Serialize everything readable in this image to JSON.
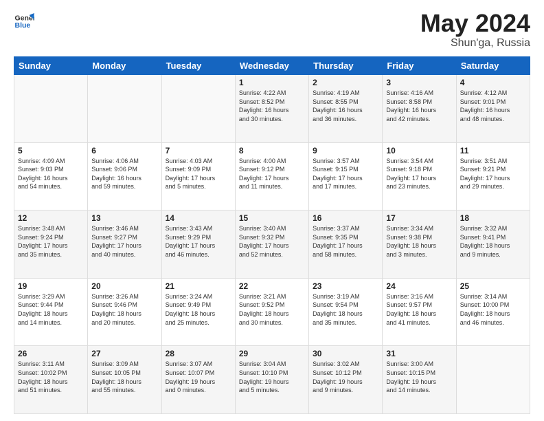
{
  "logo": {
    "line1": "General",
    "line2": "Blue"
  },
  "title": {
    "month_year": "May 2024",
    "location": "Shun'ga, Russia"
  },
  "days_of_week": [
    "Sunday",
    "Monday",
    "Tuesday",
    "Wednesday",
    "Thursday",
    "Friday",
    "Saturday"
  ],
  "weeks": [
    [
      {
        "day": "",
        "info": ""
      },
      {
        "day": "",
        "info": ""
      },
      {
        "day": "",
        "info": ""
      },
      {
        "day": "1",
        "info": "Sunrise: 4:22 AM\nSunset: 8:52 PM\nDaylight: 16 hours\nand 30 minutes."
      },
      {
        "day": "2",
        "info": "Sunrise: 4:19 AM\nSunset: 8:55 PM\nDaylight: 16 hours\nand 36 minutes."
      },
      {
        "day": "3",
        "info": "Sunrise: 4:16 AM\nSunset: 8:58 PM\nDaylight: 16 hours\nand 42 minutes."
      },
      {
        "day": "4",
        "info": "Sunrise: 4:12 AM\nSunset: 9:01 PM\nDaylight: 16 hours\nand 48 minutes."
      }
    ],
    [
      {
        "day": "5",
        "info": "Sunrise: 4:09 AM\nSunset: 9:03 PM\nDaylight: 16 hours\nand 54 minutes."
      },
      {
        "day": "6",
        "info": "Sunrise: 4:06 AM\nSunset: 9:06 PM\nDaylight: 16 hours\nand 59 minutes."
      },
      {
        "day": "7",
        "info": "Sunrise: 4:03 AM\nSunset: 9:09 PM\nDaylight: 17 hours\nand 5 minutes."
      },
      {
        "day": "8",
        "info": "Sunrise: 4:00 AM\nSunset: 9:12 PM\nDaylight: 17 hours\nand 11 minutes."
      },
      {
        "day": "9",
        "info": "Sunrise: 3:57 AM\nSunset: 9:15 PM\nDaylight: 17 hours\nand 17 minutes."
      },
      {
        "day": "10",
        "info": "Sunrise: 3:54 AM\nSunset: 9:18 PM\nDaylight: 17 hours\nand 23 minutes."
      },
      {
        "day": "11",
        "info": "Sunrise: 3:51 AM\nSunset: 9:21 PM\nDaylight: 17 hours\nand 29 minutes."
      }
    ],
    [
      {
        "day": "12",
        "info": "Sunrise: 3:48 AM\nSunset: 9:24 PM\nDaylight: 17 hours\nand 35 minutes."
      },
      {
        "day": "13",
        "info": "Sunrise: 3:46 AM\nSunset: 9:27 PM\nDaylight: 17 hours\nand 40 minutes."
      },
      {
        "day": "14",
        "info": "Sunrise: 3:43 AM\nSunset: 9:29 PM\nDaylight: 17 hours\nand 46 minutes."
      },
      {
        "day": "15",
        "info": "Sunrise: 3:40 AM\nSunset: 9:32 PM\nDaylight: 17 hours\nand 52 minutes."
      },
      {
        "day": "16",
        "info": "Sunrise: 3:37 AM\nSunset: 9:35 PM\nDaylight: 17 hours\nand 58 minutes."
      },
      {
        "day": "17",
        "info": "Sunrise: 3:34 AM\nSunset: 9:38 PM\nDaylight: 18 hours\nand 3 minutes."
      },
      {
        "day": "18",
        "info": "Sunrise: 3:32 AM\nSunset: 9:41 PM\nDaylight: 18 hours\nand 9 minutes."
      }
    ],
    [
      {
        "day": "19",
        "info": "Sunrise: 3:29 AM\nSunset: 9:44 PM\nDaylight: 18 hours\nand 14 minutes."
      },
      {
        "day": "20",
        "info": "Sunrise: 3:26 AM\nSunset: 9:46 PM\nDaylight: 18 hours\nand 20 minutes."
      },
      {
        "day": "21",
        "info": "Sunrise: 3:24 AM\nSunset: 9:49 PM\nDaylight: 18 hours\nand 25 minutes."
      },
      {
        "day": "22",
        "info": "Sunrise: 3:21 AM\nSunset: 9:52 PM\nDaylight: 18 hours\nand 30 minutes."
      },
      {
        "day": "23",
        "info": "Sunrise: 3:19 AM\nSunset: 9:54 PM\nDaylight: 18 hours\nand 35 minutes."
      },
      {
        "day": "24",
        "info": "Sunrise: 3:16 AM\nSunset: 9:57 PM\nDaylight: 18 hours\nand 41 minutes."
      },
      {
        "day": "25",
        "info": "Sunrise: 3:14 AM\nSunset: 10:00 PM\nDaylight: 18 hours\nand 46 minutes."
      }
    ],
    [
      {
        "day": "26",
        "info": "Sunrise: 3:11 AM\nSunset: 10:02 PM\nDaylight: 18 hours\nand 51 minutes."
      },
      {
        "day": "27",
        "info": "Sunrise: 3:09 AM\nSunset: 10:05 PM\nDaylight: 18 hours\nand 55 minutes."
      },
      {
        "day": "28",
        "info": "Sunrise: 3:07 AM\nSunset: 10:07 PM\nDaylight: 19 hours\nand 0 minutes."
      },
      {
        "day": "29",
        "info": "Sunrise: 3:04 AM\nSunset: 10:10 PM\nDaylight: 19 hours\nand 5 minutes."
      },
      {
        "day": "30",
        "info": "Sunrise: 3:02 AM\nSunset: 10:12 PM\nDaylight: 19 hours\nand 9 minutes."
      },
      {
        "day": "31",
        "info": "Sunrise: 3:00 AM\nSunset: 10:15 PM\nDaylight: 19 hours\nand 14 minutes."
      },
      {
        "day": "",
        "info": ""
      }
    ]
  ]
}
